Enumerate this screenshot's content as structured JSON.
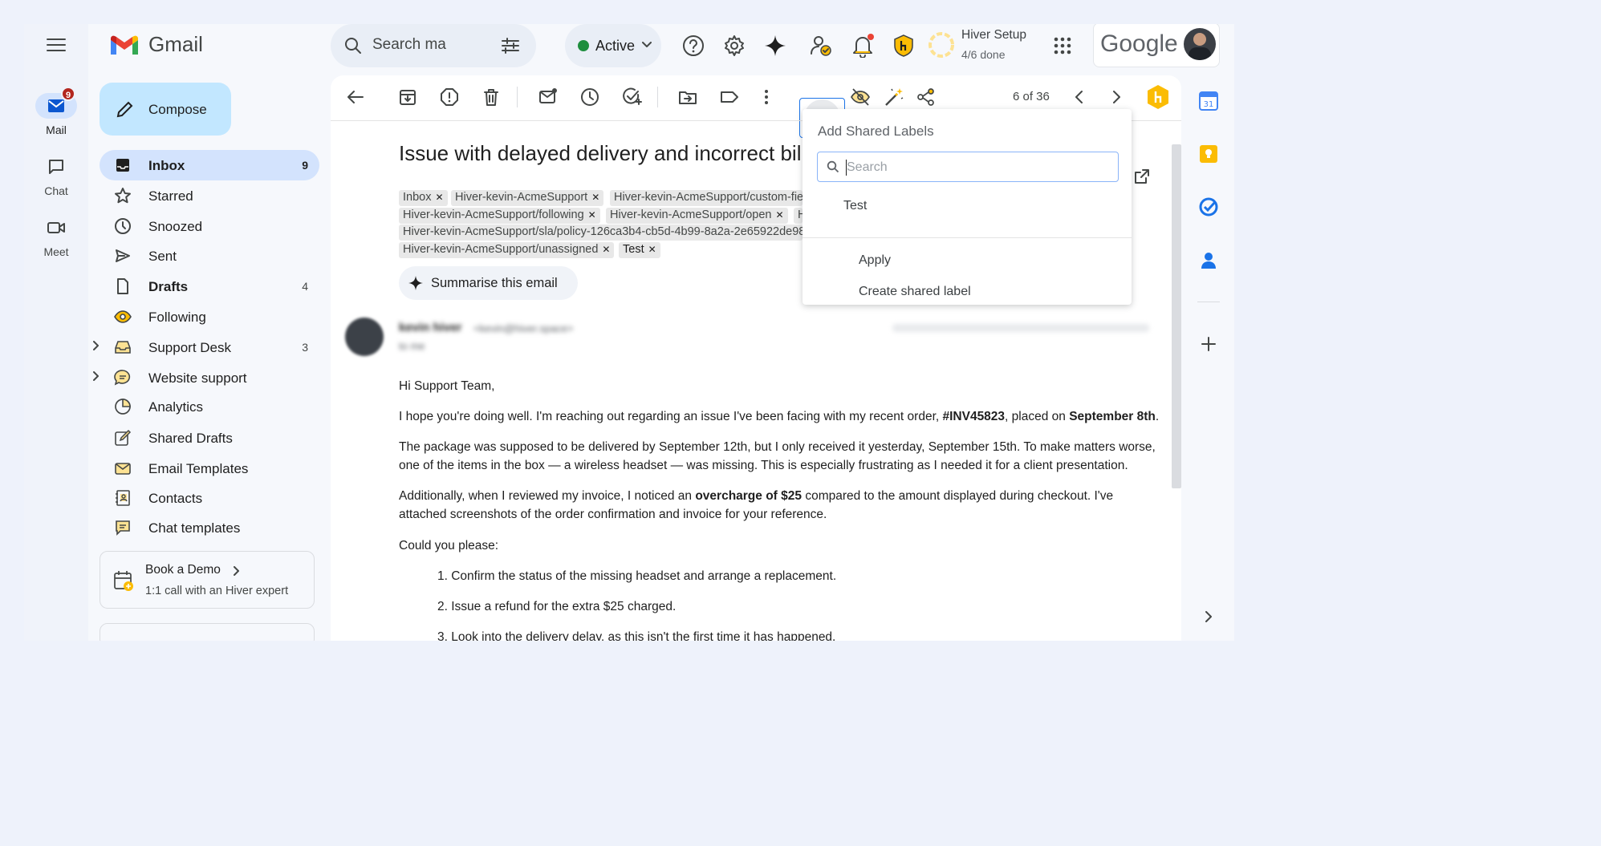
{
  "app": {
    "name": "Gmail",
    "accent": "#d3e3fd",
    "compose_color": "#c2e7ff"
  },
  "rail": {
    "items": [
      {
        "label": "Mail",
        "icon": "mail-icon",
        "badge": "9"
      },
      {
        "label": "Chat",
        "icon": "chat-icon"
      },
      {
        "label": "Meet",
        "icon": "video-icon"
      }
    ]
  },
  "header": {
    "search_placeholder": "Search ma",
    "status_label": "Active",
    "setup_title": "Hiver Setup",
    "setup_progress": "4/6 done",
    "google_label": "Google"
  },
  "nav": {
    "compose_label": "Compose",
    "items": [
      {
        "label": "Inbox",
        "count": "9",
        "icon": "inbox-icon"
      },
      {
        "label": "Starred",
        "count": "",
        "icon": "star-icon"
      },
      {
        "label": "Snoozed",
        "count": "",
        "icon": "clock-icon"
      },
      {
        "label": "Sent",
        "count": "",
        "icon": "send-icon"
      },
      {
        "label": "Drafts",
        "count": "4",
        "icon": "draft-icon"
      },
      {
        "label": "Following",
        "count": "",
        "icon": "eye-icon"
      },
      {
        "label": "Support Desk",
        "count": "3",
        "icon": "tray-icon"
      },
      {
        "label": "Website support",
        "count": "",
        "icon": "chat-bubble-icon"
      },
      {
        "label": "Analytics",
        "count": "",
        "icon": "pie-chart-icon"
      },
      {
        "label": "Shared Drafts",
        "count": "",
        "icon": "edit-icon"
      },
      {
        "label": "Email Templates",
        "count": "",
        "icon": "template-icon"
      },
      {
        "label": "Contacts",
        "count": "",
        "icon": "contacts-icon"
      },
      {
        "label": "Chat templates",
        "count": "",
        "icon": "chat-template-icon"
      }
    ],
    "demo_title": "Book a Demo",
    "demo_subtitle": "1:1 call with an Hiver expert"
  },
  "toolbar": {
    "pager": "6 of 36"
  },
  "email": {
    "subject": "Issue with delayed delivery and incorrect bil",
    "labels": [
      "Inbox",
      "Hiver-kevin-AcmeSupport",
      "Hiver-kevin-AcmeSupport/custom-fie",
      "Hiver-kevin-AcmeSupport/following",
      "Hiver-kevin-AcmeSupport/open",
      "H",
      "Hiver-kevin-AcmeSupport/sla/policy-126ca3b4-cb5d-4b99-8a2a-2e65922de98",
      "Hiver-kevin-AcmeSupport/unassigned",
      "Test"
    ],
    "summarise_label": "Summarise this email",
    "sender_name": "kevin hiver",
    "sender_email": "<kevin@hiver.space>",
    "to_line": "to me",
    "greeting": "Hi Support Team,",
    "p1_a": "I hope you're doing well. I'm reaching out regarding an issue I've been facing with my recent order, ",
    "p1_order": "#INV45823",
    "p1_b": ", placed on ",
    "p1_date": "September 8th",
    "p1_c": ".",
    "p2_l1": "The package was supposed to be delivered by September 12th, but I only received it yesterday, September 15th. To make matters worse,",
    "p2_l2": "one of the items in the box — a wireless headset — was missing. This is especially frustrating as I needed it for a client presentation.",
    "p3_a": "Additionally, when I reviewed my invoice, I noticed an ",
    "p3_bold": "overcharge of $25",
    "p3_b": " compared to the amount displayed during checkout. I've",
    "p3_l2": "attached screenshots of the order confirmation and invoice for your reference.",
    "p4": "Could you please:",
    "list": [
      "1. Confirm the status of the missing headset and arrange a replacement.",
      "2. Issue a refund for the extra $25 charged.",
      "3. Look into the delivery delay, as this isn't the first time it has happened."
    ]
  },
  "shared_labels_menu": {
    "title": "Add Shared Labels",
    "search_placeholder": "Search",
    "options": [
      "Test"
    ],
    "apply_label": "Apply",
    "create_label": "Create shared label"
  }
}
